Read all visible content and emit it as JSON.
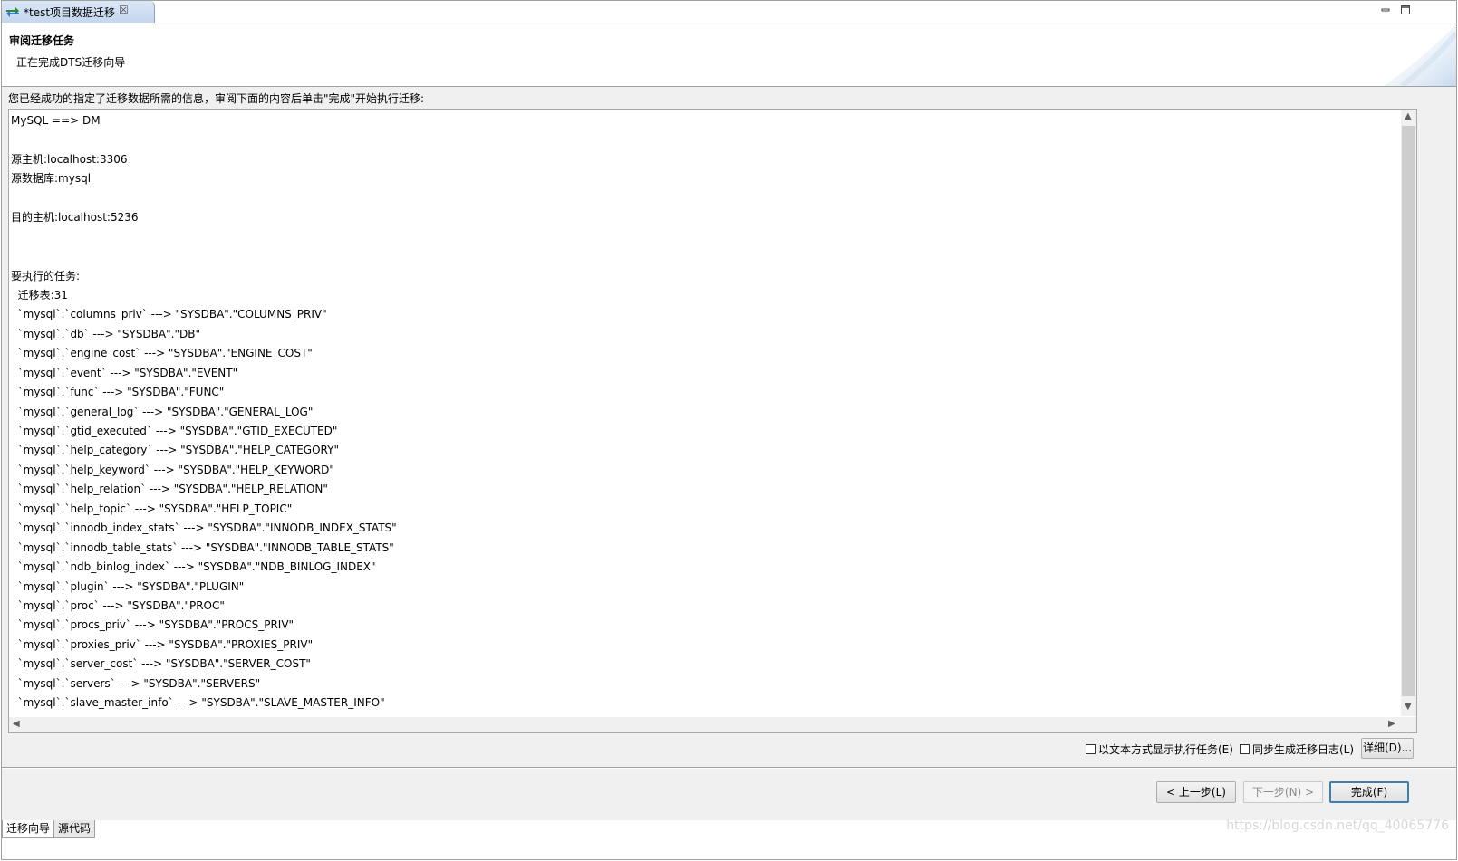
{
  "tab": {
    "title": "*test项目数据迁移",
    "close": "☒"
  },
  "header": {
    "title": "审阅迁移任务",
    "subtitle": "正在完成DTS迁移向导"
  },
  "instruction": "您已经成功的指定了迁移数据所需的信息，审阅下面的内容后单击\"完成\"开始执行迁移:",
  "summary_lines": [
    "MySQL ==> DM",
    "",
    "源主机:localhost:3306",
    "源数据库:mysql",
    "",
    "目的主机:localhost:5236",
    "",
    "",
    "要执行的任务:",
    "  迁移表:31",
    "  `mysql`.`columns_priv` ---> \"SYSDBA\".\"COLUMNS_PRIV\"",
    "  `mysql`.`db` ---> \"SYSDBA\".\"DB\"",
    "  `mysql`.`engine_cost` ---> \"SYSDBA\".\"ENGINE_COST\"",
    "  `mysql`.`event` ---> \"SYSDBA\".\"EVENT\"",
    "  `mysql`.`func` ---> \"SYSDBA\".\"FUNC\"",
    "  `mysql`.`general_log` ---> \"SYSDBA\".\"GENERAL_LOG\"",
    "  `mysql`.`gtid_executed` ---> \"SYSDBA\".\"GTID_EXECUTED\"",
    "  `mysql`.`help_category` ---> \"SYSDBA\".\"HELP_CATEGORY\"",
    "  `mysql`.`help_keyword` ---> \"SYSDBA\".\"HELP_KEYWORD\"",
    "  `mysql`.`help_relation` ---> \"SYSDBA\".\"HELP_RELATION\"",
    "  `mysql`.`help_topic` ---> \"SYSDBA\".\"HELP_TOPIC\"",
    "  `mysql`.`innodb_index_stats` ---> \"SYSDBA\".\"INNODB_INDEX_STATS\"",
    "  `mysql`.`innodb_table_stats` ---> \"SYSDBA\".\"INNODB_TABLE_STATS\"",
    "  `mysql`.`ndb_binlog_index` ---> \"SYSDBA\".\"NDB_BINLOG_INDEX\"",
    "  `mysql`.`plugin` ---> \"SYSDBA\".\"PLUGIN\"",
    "  `mysql`.`proc` ---> \"SYSDBA\".\"PROC\"",
    "  `mysql`.`procs_priv` ---> \"SYSDBA\".\"PROCS_PRIV\"",
    "  `mysql`.`proxies_priv` ---> \"SYSDBA\".\"PROXIES_PRIV\"",
    "  `mysql`.`server_cost` ---> \"SYSDBA\".\"SERVER_COST\"",
    "  `mysql`.`servers` ---> \"SYSDBA\".\"SERVERS\"",
    "  `mysql`.`slave_master_info` ---> \"SYSDBA\".\"SLAVE_MASTER_INFO\""
  ],
  "options": {
    "show_as_text": {
      "label": "以文本方式显示执行任务(E)",
      "checked": false
    },
    "sync_log": {
      "label": "同步生成迁移日志(L)",
      "checked": false
    },
    "details_button": "详细(D)..."
  },
  "nav_buttons": {
    "back": "< 上一步(L)",
    "next": "下一步(N) >",
    "finish": "完成(F)"
  },
  "bottom_tabs": [
    "迁移向导",
    "源代码"
  ],
  "watermark": "https://blog.csdn.net/qq_40065776",
  "colors": {
    "accent_border": "#3c7fb1",
    "disabled_text": "#8c8c8c"
  }
}
